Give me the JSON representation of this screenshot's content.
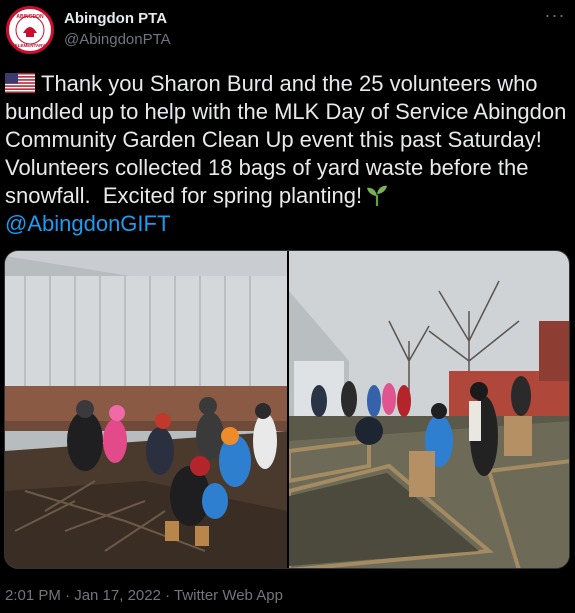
{
  "account": {
    "display_name": "Abingdon PTA",
    "handle": "@AbingdonPTA",
    "avatar_icon": "abingdon-elementary-seal",
    "avatar_text": "ABINGDON ELEMENTARY"
  },
  "tweet": {
    "flag_icon": "us-flag-icon",
    "body": "Thank you Sharon Burd and the 25 volunteers who bundled up to help with the MLK Day of Service Abingdon Community Garden Clean Up event this past Saturday! Volunteers collected 18 bags of yard waste before the snowfall.  Excited for spring planting!",
    "sprout_icon": "seedling-icon",
    "mention": "@AbingdonGIFT"
  },
  "meta": {
    "timestamp": "2:01 PM · Jan 17, 2022 · Twitter Web App"
  },
  "menu": {
    "more_label": "···"
  },
  "colors": {
    "background": "#000000",
    "text": "#e7e9ea",
    "secondary": "#71767b",
    "link": "#1d9bf0"
  }
}
